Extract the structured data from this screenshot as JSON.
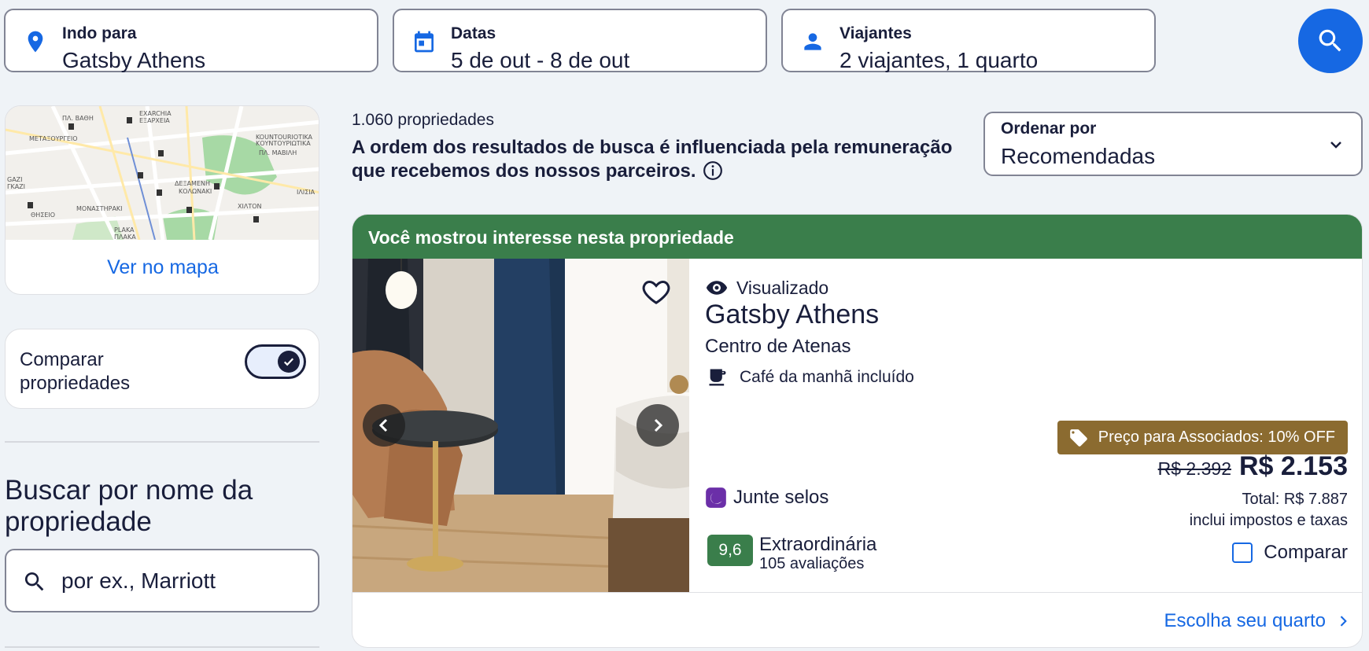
{
  "search": {
    "destination": {
      "label": "Indo para",
      "value": "Gatsby Athens"
    },
    "dates": {
      "label": "Datas",
      "value": "5 de out - 8 de out"
    },
    "travelers": {
      "label": "Viajantes",
      "value": "2 viajantes, 1 quarto"
    }
  },
  "sidebar": {
    "map_link": "Ver no mapa",
    "compare_label": "Comparar propriedades",
    "compare_enabled": true,
    "name_search_heading": "Buscar por nome da propriedade",
    "name_search_placeholder": "por ex., Marriott"
  },
  "results": {
    "count": "1.060 propriedades",
    "disclaimer": "A ordem dos resultados de busca é influenciada pela remuneração que recebemos dos nossos parceiros.",
    "sort_label": "Ordenar por",
    "sort_value": "Recomendadas"
  },
  "property": {
    "banner": "Você mostrou interesse nesta propriedade",
    "viewed": "Visualizado",
    "name": "Gatsby Athens",
    "location": "Centro de Atenas",
    "amenity": "Café da manhã incluído",
    "stamps": "Junte selos",
    "member_badge": "Preço para Associados: 10% OFF",
    "old_price": "R$ 2.392",
    "price": "R$ 2.153",
    "total": "Total: R$ 7.887",
    "taxes_note": "inclui impostos e taxas",
    "compare": "Comparar",
    "rating_score": "9,6",
    "rating_label": "Extraordinária",
    "rating_count": "105 avaliações",
    "choose_room": "Escolha seu quarto"
  },
  "map_labels": [
    "ΠΛ. ΒΑΘΗ",
    "EXARCHIA",
    "ΕΞΑΡΧΕΙΑ",
    "ΜΕΤΑΞΟΥΡΓΕΙΟ",
    "KOUNTOURIOTIKA",
    "ΚΟΥΝΤΟΥΡΙΩΤΙΚΑ",
    "ΠΛ. ΜΑΒΙΛΗ",
    "GAZI",
    "ΓΚΑΖΙ",
    "ΔΕΞΑΜΕΝΗ",
    "ΚΟΛΩΝΑΚΙ",
    "ΙΛΙΣΙΑ",
    "ΜΟΝΑΣΤΗΡΑΚΙ",
    "ΧΙΛΤΟΝ",
    "ΘΗΣΕΙΟ",
    "PLAKA",
    "ΠΛΑΚΑ"
  ],
  "colors": {
    "primary": "#1668e3",
    "success": "#3a7e4b",
    "member": "#8b6b30",
    "text": "#191e3b",
    "stamps": "#6b2fa8"
  },
  "icons": [
    "location-pin-icon",
    "calendar-icon",
    "person-icon",
    "search-icon",
    "info-icon",
    "chevron-down-icon",
    "heart-icon",
    "eye-icon",
    "coffee-icon",
    "stamps-icon",
    "tag-icon",
    "chevron-left-icon",
    "chevron-right-icon",
    "check-icon"
  ]
}
